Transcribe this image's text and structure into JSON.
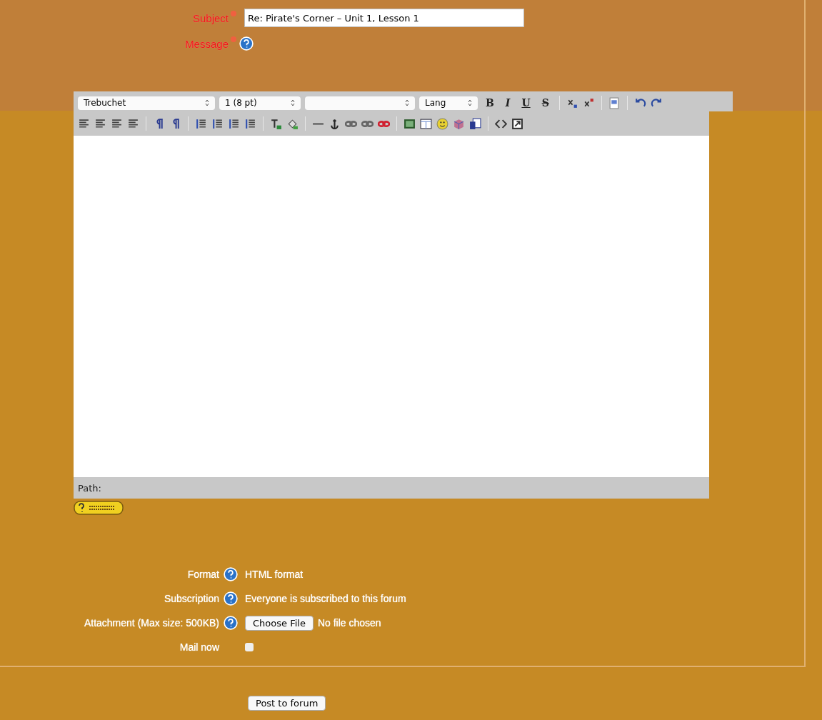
{
  "form": {
    "subject": {
      "label": "Subject",
      "required": true,
      "value": "Re: Pirate's Corner – Unit 1, Lesson 1"
    },
    "message": {
      "label": "Message",
      "required": true,
      "help": true
    }
  },
  "editor": {
    "font_select": "Trebuchet",
    "size_select": "1 (8 pt)",
    "lang_select": "Lang",
    "format_buttons": [
      "B",
      "I",
      "U",
      "S"
    ],
    "path_label": "Path:"
  },
  "fields": [
    {
      "kind": "text",
      "label": "Format",
      "help": true,
      "value": "HTML format"
    },
    {
      "kind": "text",
      "label": "Subscription",
      "help": true,
      "value": "Everyone is subscribed to this forum"
    },
    {
      "kind": "file",
      "label": "Attachment (Max size: 500KB)",
      "help": true,
      "button": "Choose File",
      "status": "No file chosen"
    },
    {
      "kind": "checkbox",
      "label": "Mail now",
      "checked": false
    }
  ],
  "submit": "Post to forum"
}
